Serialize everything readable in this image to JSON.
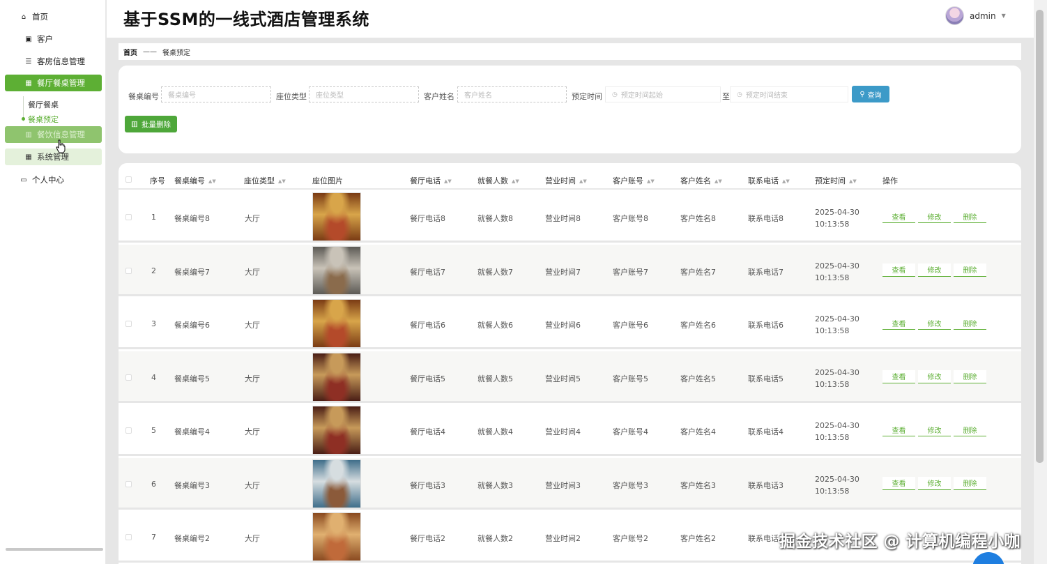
{
  "app_title": "基于SSM的一线式酒店管理系统",
  "user": {
    "name": "admin"
  },
  "sidebar": {
    "items": [
      {
        "label": "首页",
        "icon": "home-icon"
      },
      {
        "label": "客户",
        "icon": "clipboard-icon"
      },
      {
        "label": "客房信息管理",
        "icon": "list-icon"
      },
      {
        "label": "餐厅餐桌管理",
        "icon": "grid-icon"
      },
      {
        "label": "餐饮信息管理",
        "icon": "bar-chart-icon"
      },
      {
        "label": "系统管理",
        "icon": "grid-icon"
      },
      {
        "label": "个人中心",
        "icon": "card-icon"
      }
    ],
    "sub_items": [
      {
        "label": "餐厅餐桌"
      },
      {
        "label": "餐桌预定"
      }
    ]
  },
  "breadcrumb": {
    "home": "首页",
    "sep": "——",
    "current": "餐桌预定"
  },
  "search": {
    "fields": [
      {
        "label": "餐桌编号",
        "placeholder": "餐桌编号"
      },
      {
        "label": "座位类型",
        "placeholder": "座位类型"
      },
      {
        "label": "客户姓名",
        "placeholder": "客户姓名"
      }
    ],
    "time_label": "预定时间",
    "time_start_placeholder": "预定时间起始",
    "time_to": "至",
    "time_end_placeholder": "预定时间结束",
    "search_button": "查询",
    "batch_delete_button": "批量删除"
  },
  "table": {
    "headers": {
      "index": "序号",
      "table_no": "餐桌编号",
      "seat_type": "座位类型",
      "seat_image": "座位图片",
      "phone": "餐厅电话",
      "diners": "就餐人数",
      "hours": "营业时间",
      "account": "客户账号",
      "name": "客户姓名",
      "contact": "联系电话",
      "reserve_time": "预定时间",
      "ops": "操作"
    },
    "ops": {
      "view": "查看",
      "edit": "修改",
      "delete": "删除"
    },
    "rows": [
      {
        "index": "1",
        "table_no": "餐桌编号8",
        "seat_type": "大厅",
        "phone": "餐厅电话8",
        "diners": "就餐人数8",
        "hours": "营业时间8",
        "account": "客户账号8",
        "name": "客户姓名8",
        "contact": "联系电话8",
        "reserve_time": "2025-04-30 10:13:58"
      },
      {
        "index": "2",
        "table_no": "餐桌编号7",
        "seat_type": "大厅",
        "phone": "餐厅电话7",
        "diners": "就餐人数7",
        "hours": "营业时间7",
        "account": "客户账号7",
        "name": "客户姓名7",
        "contact": "联系电话7",
        "reserve_time": "2025-04-30 10:13:58"
      },
      {
        "index": "3",
        "table_no": "餐桌编号6",
        "seat_type": "大厅",
        "phone": "餐厅电话6",
        "diners": "就餐人数6",
        "hours": "营业时间6",
        "account": "客户账号6",
        "name": "客户姓名6",
        "contact": "联系电话6",
        "reserve_time": "2025-04-30 10:13:58"
      },
      {
        "index": "4",
        "table_no": "餐桌编号5",
        "seat_type": "大厅",
        "phone": "餐厅电话5",
        "diners": "就餐人数5",
        "hours": "营业时间5",
        "account": "客户账号5",
        "name": "客户姓名5",
        "contact": "联系电话5",
        "reserve_time": "2025-04-30 10:13:58"
      },
      {
        "index": "5",
        "table_no": "餐桌编号4",
        "seat_type": "大厅",
        "phone": "餐厅电话4",
        "diners": "就餐人数4",
        "hours": "营业时间4",
        "account": "客户账号4",
        "name": "客户姓名4",
        "contact": "联系电话4",
        "reserve_time": "2025-04-30 10:13:58"
      },
      {
        "index": "6",
        "table_no": "餐桌编号3",
        "seat_type": "大厅",
        "phone": "餐厅电话3",
        "diners": "就餐人数3",
        "hours": "营业时间3",
        "account": "客户账号3",
        "name": "客户姓名3",
        "contact": "联系电话3",
        "reserve_time": "2025-04-30 10:13:58"
      },
      {
        "index": "7",
        "table_no": "餐桌编号2",
        "seat_type": "大厅",
        "phone": "餐厅电话2",
        "diners": "就餐人数2",
        "hours": "营业时间2",
        "account": "客户账号2",
        "name": "客户姓名2",
        "contact": "联系电话2",
        "reserve_time": ""
      }
    ]
  },
  "watermark": "掘金技术社区 @ 计算机编程小咖",
  "colors": {
    "accent": "#5daf34",
    "search_button": "#3c9ac8",
    "batch_button": "#4ea73a"
  }
}
